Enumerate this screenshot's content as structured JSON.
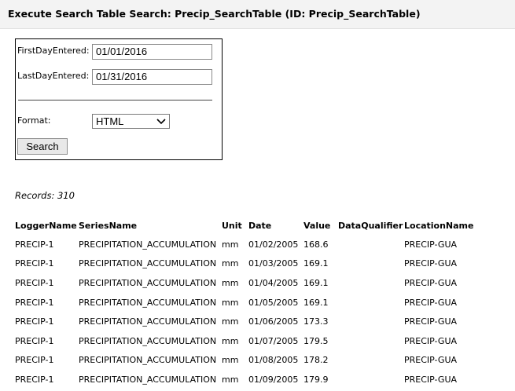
{
  "header": {
    "title": "Execute Search Table Search: Precip_SearchTable (ID: Precip_SearchTable)"
  },
  "form": {
    "first_day_label": "FirstDayEntered:",
    "first_day_value": "01/01/2016",
    "last_day_label": "LastDayEntered:",
    "last_day_value": "01/31/2016",
    "format_label": "Format:",
    "format_value": "HTML",
    "search_button": "Search"
  },
  "records": "Records: 310",
  "table": {
    "headers": [
      "LoggerName",
      "SeriesName",
      "Unit",
      "Date",
      "Value",
      "DataQualifier",
      "LocationName"
    ],
    "rows": [
      [
        "PRECIP-1",
        "PRECIPITATION_ACCUMULATION",
        "mm",
        "01/02/2005",
        "168.6",
        "",
        "PRECIP-GUA"
      ],
      [
        "PRECIP-1",
        "PRECIPITATION_ACCUMULATION",
        "mm",
        "01/03/2005",
        "169.1",
        "",
        "PRECIP-GUA"
      ],
      [
        "PRECIP-1",
        "PRECIPITATION_ACCUMULATION",
        "mm",
        "01/04/2005",
        "169.1",
        "",
        "PRECIP-GUA"
      ],
      [
        "PRECIP-1",
        "PRECIPITATION_ACCUMULATION",
        "mm",
        "01/05/2005",
        "169.1",
        "",
        "PRECIP-GUA"
      ],
      [
        "PRECIP-1",
        "PRECIPITATION_ACCUMULATION",
        "mm",
        "01/06/2005",
        "173.3",
        "",
        "PRECIP-GUA"
      ],
      [
        "PRECIP-1",
        "PRECIPITATION_ACCUMULATION",
        "mm",
        "01/07/2005",
        "179.5",
        "",
        "PRECIP-GUA"
      ],
      [
        "PRECIP-1",
        "PRECIPITATION_ACCUMULATION",
        "mm",
        "01/08/2005",
        "178.2",
        "",
        "PRECIP-GUA"
      ],
      [
        "PRECIP-1",
        "PRECIPITATION_ACCUMULATION",
        "mm",
        "01/09/2005",
        "179.9",
        "",
        "PRECIP-GUA"
      ]
    ]
  }
}
